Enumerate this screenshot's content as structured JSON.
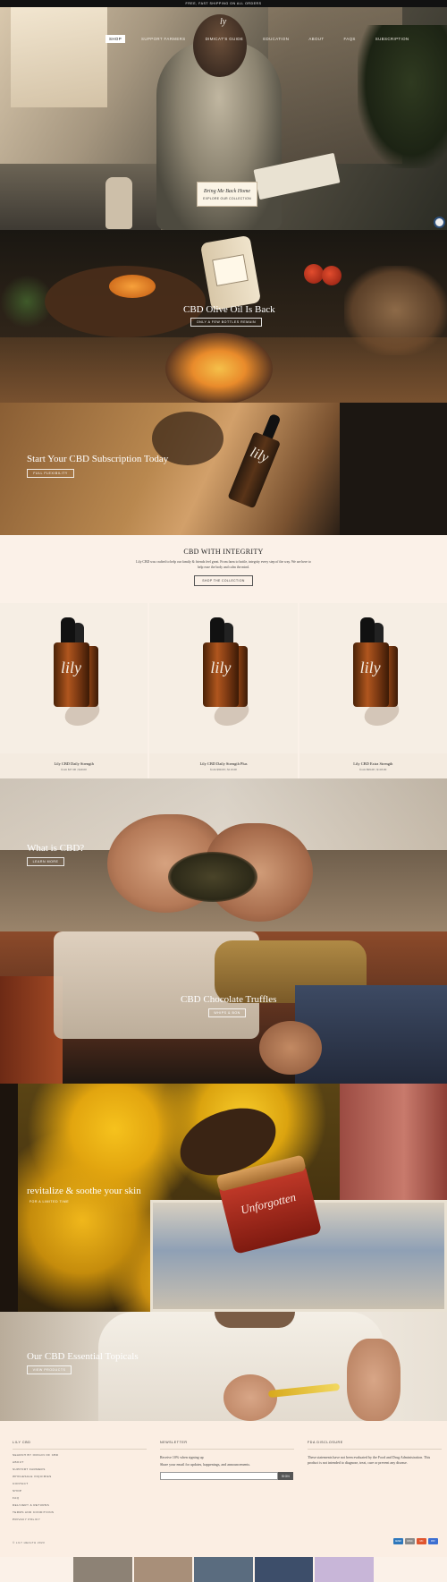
{
  "announcement": "FREE, FAST SHIPPING ON ALL ORDERS",
  "logo": "ly",
  "nav": [
    "SHOP",
    "SUPPORT FARMERS",
    "DIMICAT'S GUIDE",
    "EDUCATION",
    "ABOUT",
    "FAQS",
    "SUBSCRIPTION"
  ],
  "hero": {
    "script": "Bring Me Back Home",
    "cta": "EXPLORE OUR COLLECTION"
  },
  "oil": {
    "title": "CBD Olive Oil Is Back",
    "cta": "ONLY A FEW BOTTLES REMAIN"
  },
  "subscription": {
    "title": "Start Your CBD Subscription Today",
    "cta": "FULL FLEXIBILITY",
    "bottle_mark": "lily"
  },
  "integrity": {
    "title": "CBD WITH INTEGRITY",
    "body": "Lily CBD was crafted to help our family & friends feel great. From farm to bottle, integrity every step of the way. We are here to help ease the body and calm the mind.",
    "cta": "SHOP THE COLLECTION"
  },
  "products": [
    {
      "name": "Lily CBD Daily Strength",
      "price": "from $37.00 | $40.00",
      "mark": "lily"
    },
    {
      "name": "Lily CBD Daily Strength Plus",
      "price": "from $99.00 | $110.00",
      "mark": "lily"
    },
    {
      "name": "Lily CBD Extra Strength",
      "price": "from $99.00 | $118.00",
      "mark": "lily"
    }
  ],
  "what": {
    "title": "What is CBD?",
    "cta": "LEARN MORE"
  },
  "truffles": {
    "title": "CBD Chocolate Truffles",
    "cta": "WHIPS & BON"
  },
  "topical": {
    "title": "revitalize & soothe your skin",
    "cta": "FOR A LIMITED TIME",
    "jar_brand": "Unforgotten"
  },
  "essential": {
    "title": "Our CBD Essential Topicals",
    "cta": "VIEW PRODUCTS"
  },
  "footer": {
    "col1": {
      "heading": "LILY CBD",
      "links": [
        "SEARCH BY ORIGIN OF CBD",
        "ABOUT",
        "SUPPORT FARMERS",
        "WHOLESALE INQUIRIES",
        "CONTACT",
        "SHOP",
        "FAQ",
        "DELIVERY & RETURNS",
        "TERMS AND CONDITIONS",
        "PRIVACY POLICY"
      ]
    },
    "col2": {
      "heading": "NEWSLETTER",
      "text1": "Receive 10% when signing up",
      "text2": "Share your email for updates, happenings, and announcements.",
      "placeholder": "",
      "button": "SIGN"
    },
    "col3": {
      "heading": "FDA DISCLOSURE",
      "text": "These statements have not been evaluated by the Food and Drug Administration. This product is not intended to diagnose, treat, cure or prevent any disease."
    },
    "copyright": "© LILY HEALTH 2023",
    "payments": [
      {
        "name": "AMEX",
        "color": "#2e77bb"
      },
      {
        "name": "DISC",
        "color": "#8a8a8a"
      },
      {
        "name": "MC",
        "color": "#e0552f"
      },
      {
        "name": "PAY",
        "color": "#3d6fd1"
      }
    ]
  },
  "instagram_colors": [
    "#8d8275",
    "#a88f79",
    "#5a6c7f",
    "#3d4e6a",
    "#c8b6d8"
  ]
}
